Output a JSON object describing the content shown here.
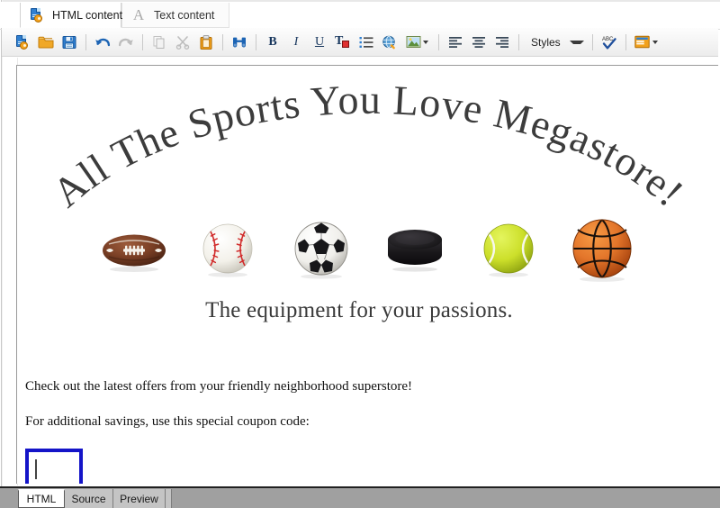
{
  "window": {
    "tabs": [
      {
        "label": "HTML content",
        "icon": "html-document-icon",
        "active": true
      },
      {
        "label": "Text content",
        "icon": "letter-a-icon",
        "active": false
      }
    ]
  },
  "toolbar": {
    "items": [
      {
        "name": "new-document-button",
        "icon": "new-html-document-icon",
        "tooltip": "New",
        "enabled": true
      },
      {
        "name": "open-button",
        "icon": "open-folder-icon",
        "tooltip": "Open",
        "enabled": true
      },
      {
        "name": "save-button",
        "icon": "floppy-disk-icon",
        "tooltip": "Save",
        "enabled": true
      },
      {
        "name": "undo-button",
        "icon": "undo-arrow-icon",
        "tooltip": "Undo",
        "enabled": true
      },
      {
        "name": "redo-button",
        "icon": "redo-arrow-icon",
        "tooltip": "Redo",
        "enabled": false
      },
      {
        "name": "copy-button",
        "icon": "copy-pages-icon",
        "tooltip": "Copy",
        "enabled": false
      },
      {
        "name": "cut-button",
        "icon": "scissors-icon",
        "tooltip": "Cut",
        "enabled": false
      },
      {
        "name": "paste-button",
        "icon": "clipboard-icon",
        "tooltip": "Paste",
        "enabled": true
      },
      {
        "name": "find-button",
        "icon": "binoculars-icon",
        "tooltip": "Find",
        "enabled": true
      },
      {
        "name": "bold-button",
        "icon": "bold-icon",
        "label": "B",
        "tooltip": "Bold",
        "enabled": true
      },
      {
        "name": "italic-button",
        "icon": "italic-icon",
        "label": "I",
        "tooltip": "Italic",
        "enabled": true
      },
      {
        "name": "underline-button",
        "icon": "underline-icon",
        "label": "U",
        "tooltip": "Underline",
        "enabled": true
      },
      {
        "name": "text-color-button",
        "icon": "text-color-icon",
        "label": "T",
        "tooltip": "Text color",
        "enabled": true
      },
      {
        "name": "bullet-list-button",
        "icon": "bullet-list-icon",
        "tooltip": "Bulleted list",
        "enabled": true
      },
      {
        "name": "insert-link-button",
        "icon": "globe-link-icon",
        "tooltip": "Insert link",
        "enabled": true
      },
      {
        "name": "insert-image-button",
        "icon": "picture-icon",
        "tooltip": "Insert image",
        "enabled": true
      },
      {
        "name": "align-left-button",
        "icon": "align-left-icon",
        "tooltip": "Align left",
        "enabled": true
      },
      {
        "name": "align-center-button",
        "icon": "align-center-icon",
        "tooltip": "Align center",
        "enabled": true
      },
      {
        "name": "align-right-button",
        "icon": "align-right-icon",
        "tooltip": "Align right",
        "enabled": true
      },
      {
        "name": "spellcheck-button",
        "icon": "abc-spellcheck-icon",
        "tooltip": "Spell check",
        "enabled": true
      },
      {
        "name": "template-button",
        "icon": "template-window-icon",
        "tooltip": "Templates",
        "enabled": true
      }
    ],
    "styles_label": "Styles"
  },
  "document": {
    "banner": {
      "arched_title": "All The Sports You Love Megastore!",
      "arched_title_color": "#3c3c3c",
      "balls": [
        {
          "name": "american-football",
          "label": "football"
        },
        {
          "name": "baseball",
          "label": "baseball"
        },
        {
          "name": "soccer-ball",
          "label": "soccer ball"
        },
        {
          "name": "hockey-puck",
          "label": "hockey puck"
        },
        {
          "name": "tennis-ball",
          "label": "tennis ball"
        },
        {
          "name": "basketball",
          "label": "basketball"
        }
      ],
      "tagline": "The equipment for your passions."
    },
    "paragraphs": [
      "Check out the latest offers from your friendly neighborhood superstore!",
      "For additional savings, use this special coupon code:"
    ],
    "coupon_field": {
      "value": "",
      "placeholder": "",
      "border_color": "#1414c8"
    }
  },
  "bottom_tabs": [
    {
      "label": "HTML",
      "active": true
    },
    {
      "label": "Source",
      "active": false
    },
    {
      "label": "Preview",
      "active": false
    }
  ]
}
